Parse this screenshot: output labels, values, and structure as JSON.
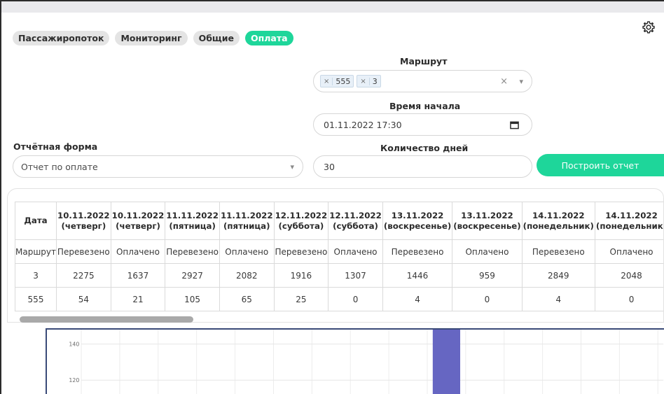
{
  "tabs": [
    {
      "label": "Пассажиропоток",
      "active": false
    },
    {
      "label": "Мониторинг",
      "active": false
    },
    {
      "label": "Общие",
      "active": false
    },
    {
      "label": "Оплата",
      "active": true
    }
  ],
  "settings_icon": "gear-icon",
  "form": {
    "route": {
      "label": "Маршрут",
      "chips": [
        "555",
        "3"
      ],
      "clear_glyph": "×",
      "dropdown_glyph": "▾"
    },
    "start_time": {
      "label": "Время начала",
      "value": "01.11.2022 17:30",
      "icon": "calendar-icon"
    },
    "report_form": {
      "label": "Отчётная форма",
      "value": "Отчет по оплате",
      "dropdown_glyph": "▾"
    },
    "days": {
      "label": "Количество дней",
      "value": "30"
    },
    "build_button": "Построить отчет"
  },
  "table": {
    "headers": [
      [
        "Дата"
      ],
      [
        "10.11.2022",
        "(четверг)"
      ],
      [
        "10.11.2022",
        "(четверг)"
      ],
      [
        "11.11.2022",
        "(пятница)"
      ],
      [
        "11.11.2022",
        "(пятница)"
      ],
      [
        "12.11.2022",
        "(суббота)"
      ],
      [
        "12.11.2022",
        "(суббота)"
      ],
      [
        "13.11.2022",
        "(воскресенье)"
      ],
      [
        "13.11.2022",
        "(воскресенье)"
      ],
      [
        "14.11.2022",
        "(понедельник)"
      ],
      [
        "14.11.2022",
        "(понедельник)"
      ]
    ],
    "rows": [
      [
        "Маршрут",
        "Перевезено",
        "Оплачено",
        "Перевезено",
        "Оплачено",
        "Перевезено",
        "Оплачено",
        "Перевезено",
        "Оплачено",
        "Перевезено",
        "Оплачено"
      ],
      [
        "3",
        "2275",
        "1637",
        "2927",
        "2082",
        "1916",
        "1307",
        "1446",
        "959",
        "2849",
        "2048"
      ],
      [
        "555",
        "54",
        "21",
        "105",
        "65",
        "25",
        "0",
        "4",
        "0",
        "4",
        "0"
      ]
    ]
  },
  "chart_data": {
    "type": "bar",
    "y_ticks": [
      140,
      120
    ],
    "ylim": [
      110,
      148
    ],
    "visible_bar": {
      "value": 148
    },
    "bar_color": "#6666c2"
  }
}
